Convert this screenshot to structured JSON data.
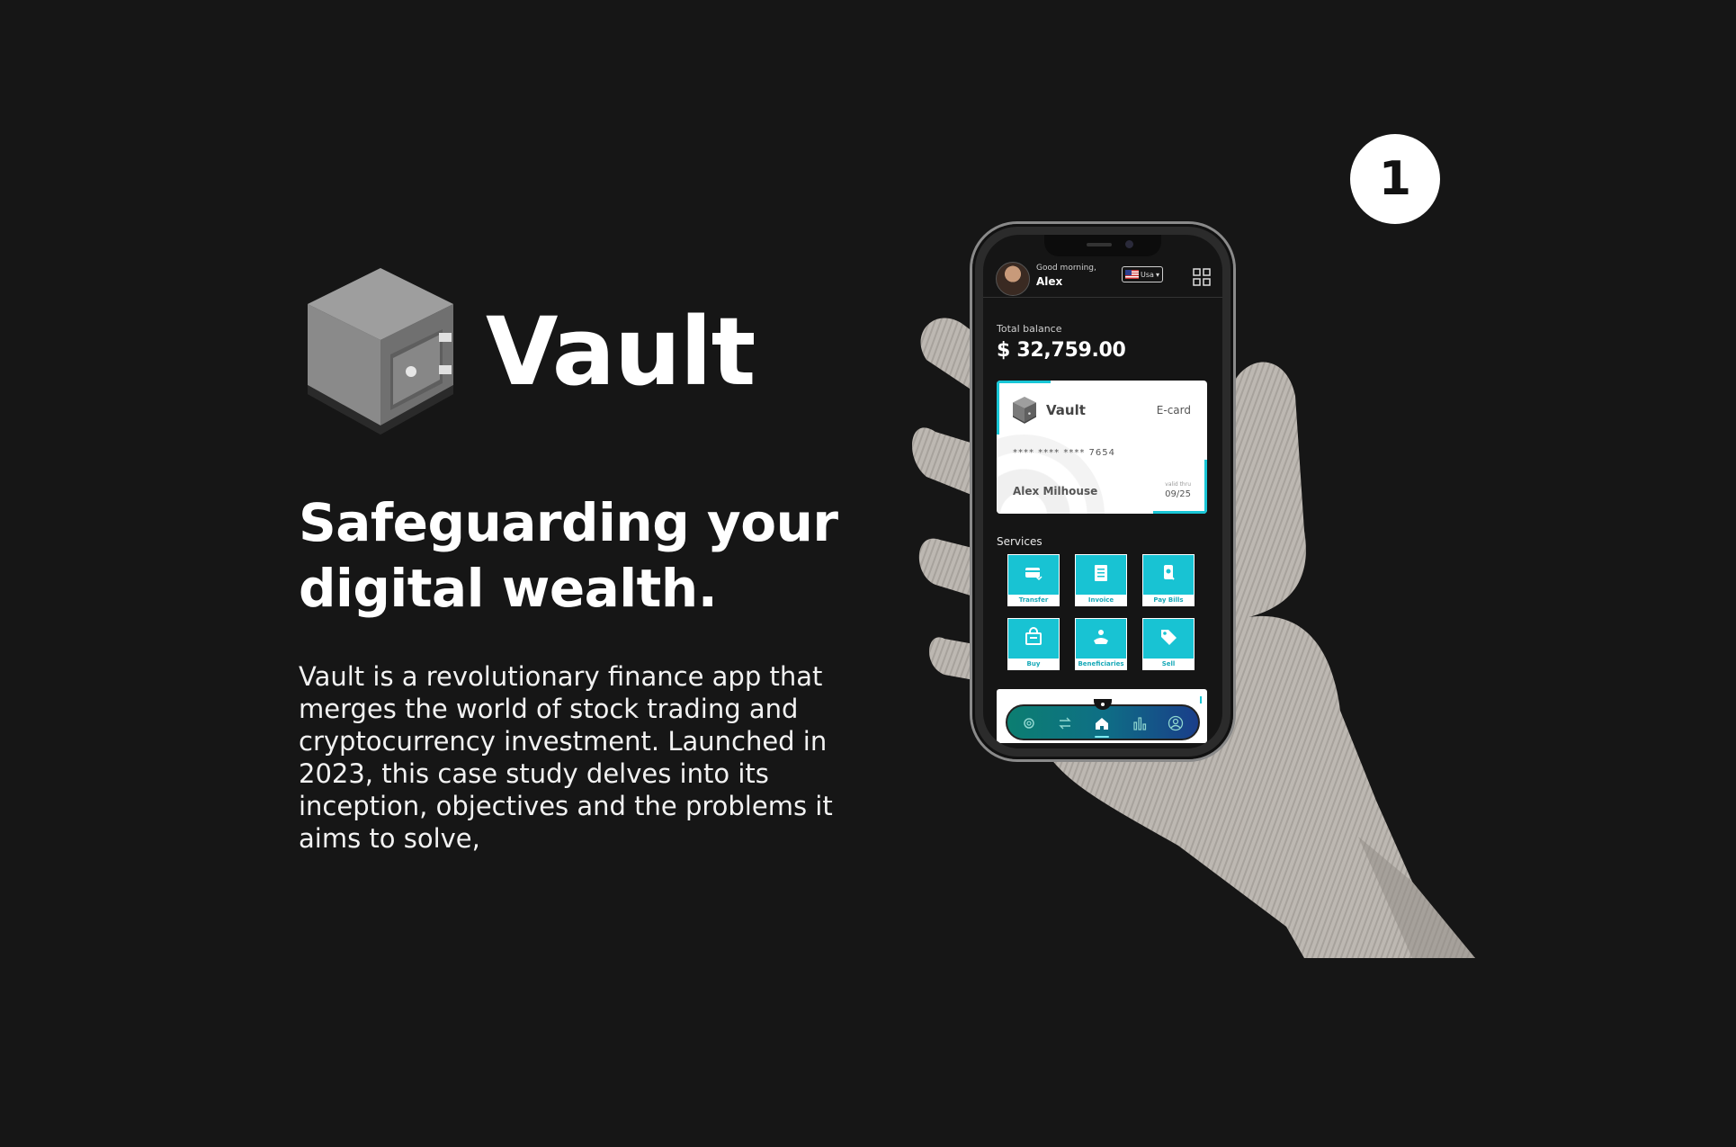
{
  "brand": {
    "name": "Vault",
    "logo_icon": "safe-icon"
  },
  "headline": "Safeguarding your digital wealth.",
  "description": "Vault is a revolutionary finance app that merges the world of stock trading and cryptocurrency investment. Launched in 2023, this case study delves into its inception, objectives and the problems it aims to solve,",
  "step_badge": "1",
  "colors": {
    "background": "#161616",
    "accent": "#18c3d3",
    "text": "#ffffff"
  },
  "phone": {
    "header": {
      "greeting": "Good morning,",
      "user_name": "Alex",
      "country": "Usa",
      "menu_icon": "grid-icon"
    },
    "balance": {
      "label": "Total balance",
      "value": "$ 32,759.00"
    },
    "card": {
      "brand": "Vault",
      "type": "E-card",
      "number": "****  ****  ****  7654",
      "holder": "Alex Milhouse",
      "expiry_label": "valid thru",
      "expiry": "09/25"
    },
    "services": {
      "title": "Services",
      "items": [
        {
          "label": "Transfer",
          "icon": "transfer-card-icon"
        },
        {
          "label": "Invoice",
          "icon": "invoice-icon"
        },
        {
          "label": "Pay Bills",
          "icon": "pay-bills-icon"
        },
        {
          "label": "Buy",
          "icon": "shopping-bag-icon"
        },
        {
          "label": "Beneficiaries",
          "icon": "beneficiaries-icon"
        },
        {
          "label": "Sell",
          "icon": "tag-icon"
        }
      ]
    },
    "bottom_nav": {
      "items": [
        "settings-icon",
        "swap-icon",
        "home-icon",
        "chart-icon",
        "profile-icon"
      ],
      "active": "home-icon"
    }
  }
}
